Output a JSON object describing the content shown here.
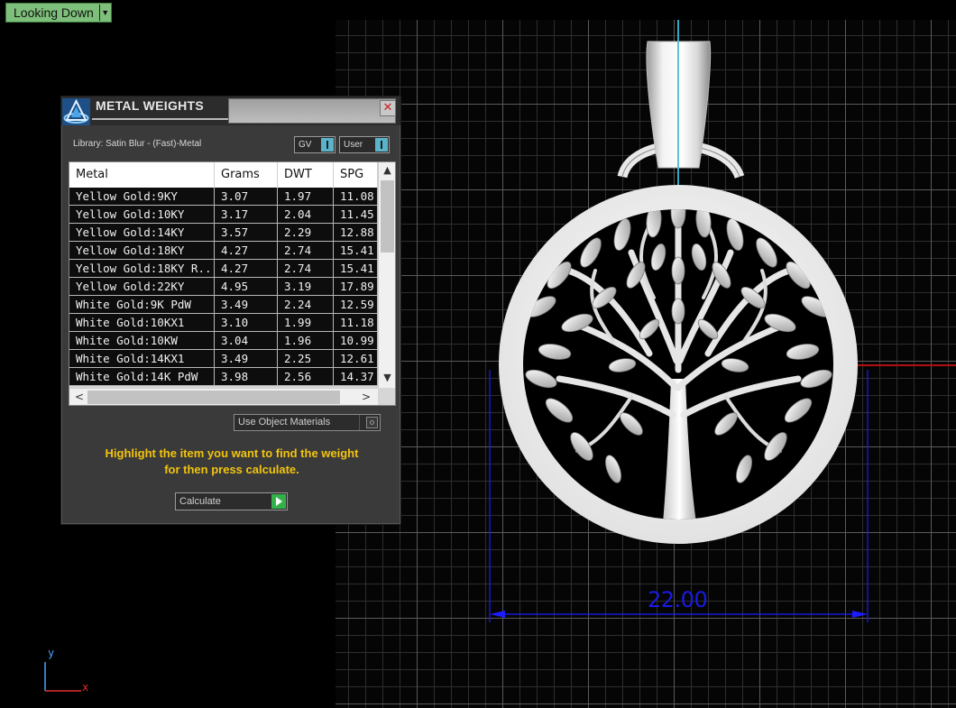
{
  "viewport": {
    "view_label": "Looking Down",
    "axis_y": "y",
    "axis_x": "x",
    "dimension": "22.00"
  },
  "panel": {
    "title": "METAL WEIGHTS",
    "library": "Library: Satin Blur - (Fast)-Metal",
    "toggle_gv": "GV",
    "toggle_user": "User",
    "columns": [
      "Metal",
      "Grams",
      "DWT",
      "SPG"
    ],
    "rows": [
      [
        "Yellow Gold:9KY",
        "3.07",
        "1.97",
        "11.08"
      ],
      [
        "Yellow Gold:10KY",
        "3.17",
        "2.04",
        "11.45"
      ],
      [
        "Yellow Gold:14KY",
        "3.57",
        "2.29",
        "12.88"
      ],
      [
        "Yellow Gold:18KY",
        "4.27",
        "2.74",
        "15.41"
      ],
      [
        "Yellow Gold:18KY R...",
        "4.27",
        "2.74",
        "15.41"
      ],
      [
        "Yellow Gold:22KY",
        "4.95",
        "3.19",
        "17.89"
      ],
      [
        "White Gold:9K PdW",
        "3.49",
        "2.24",
        "12.59"
      ],
      [
        "White Gold:10KX1",
        "3.10",
        "1.99",
        "11.18"
      ],
      [
        "White Gold:10KW",
        "3.04",
        "1.96",
        "10.99"
      ],
      [
        "White Gold:14KX1",
        "3.49",
        "2.25",
        "12.61"
      ],
      [
        "White Gold:14K PdW",
        "3.98",
        "2.56",
        "14.37"
      ]
    ],
    "use_object_materials": "Use Object Materials",
    "instruction_line1": "Highlight the item you want to find the weight",
    "instruction_line2": "for then press calculate.",
    "calculate_label": "Calculate"
  },
  "colors": {
    "view_label_bg": "#7ec07b",
    "instruction_text": "#f2c40f",
    "dimension_line": "#1c1cff",
    "toggle_accent": "#5ab3c8",
    "calculate_go": "#32b34a"
  }
}
